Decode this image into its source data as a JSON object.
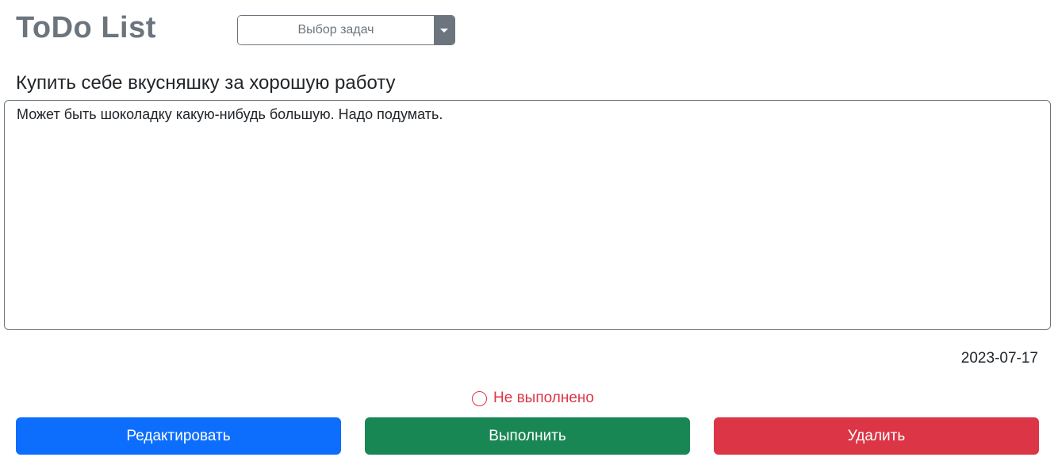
{
  "header": {
    "app_title": "ToDo List",
    "task_select": {
      "label": "Выбор задач",
      "toggle_icon": "caret-down-icon"
    }
  },
  "task": {
    "title": "Купить себе вкусняшку за хорошую работу",
    "description": "Может быть шоколадку какую-нибудь большую. Надо подумать.",
    "date": "2023-07-17",
    "status": {
      "icon": "circle-icon",
      "label": "Не выполнено",
      "color": "#dc3545"
    }
  },
  "actions": {
    "edit_label": "Редактировать",
    "complete_label": "Выполнить",
    "delete_label": "Удалить"
  },
  "colors": {
    "primary": "#0d6efd",
    "success": "#198754",
    "danger": "#dc3545",
    "secondary": "#6c757d"
  }
}
